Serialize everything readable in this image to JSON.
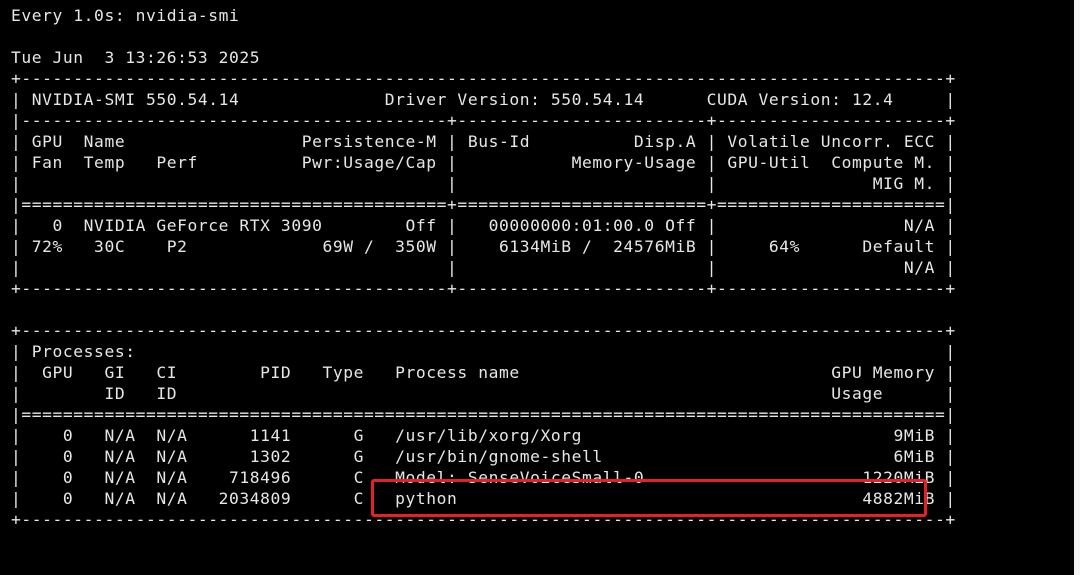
{
  "terminal": {
    "lines": [
      "Every 1.0s: nvidia-smi",
      "",
      "Tue Jun  3 13:26:53 2025",
      "+-----------------------------------------------------------------------------------------+",
      "| NVIDIA-SMI 550.54.14              Driver Version: 550.54.14      CUDA Version: 12.4     |",
      "|-----------------------------------------+------------------------+----------------------+",
      "| GPU  Name                 Persistence-M | Bus-Id          Disp.A | Volatile Uncorr. ECC |",
      "| Fan  Temp   Perf          Pwr:Usage/Cap |           Memory-Usage | GPU-Util  Compute M. |",
      "|                                         |                        |               MIG M. |",
      "|=========================================+========================+======================|",
      "|   0  NVIDIA GeForce RTX 3090        Off |   00000000:01:00.0 Off |                  N/A |",
      "| 72%   30C    P2             69W /  350W |    6134MiB /  24576MiB |     64%      Default |",
      "|                                         |                        |                  N/A |",
      "+-----------------------------------------+------------------------+----------------------+",
      "",
      "+-----------------------------------------------------------------------------------------+",
      "| Processes:                                                                              |",
      "|  GPU   GI   CI        PID   Type   Process name                              GPU Memory |",
      "|        ID   ID                                                               Usage      |",
      "|=========================================================================================|",
      "|    0   N/A  N/A      1141      G   /usr/lib/xorg/Xorg                              9MiB |",
      "|    0   N/A  N/A      1302      G   /usr/bin/gnome-shell                            6MiB |",
      "|    0   N/A  N/A    718496      C   Model: SenseVoiceSmall-0                     1220MiB |",
      "|    0   N/A  N/A   2034809      C   python                                       4882MiB |",
      "+-----------------------------------------------------------------------------------------+"
    ]
  },
  "colors": {
    "background": "#000000",
    "text": "#e6e6e6",
    "highlight": "#e4202a",
    "scrollbar": "#f3f3f3"
  }
}
